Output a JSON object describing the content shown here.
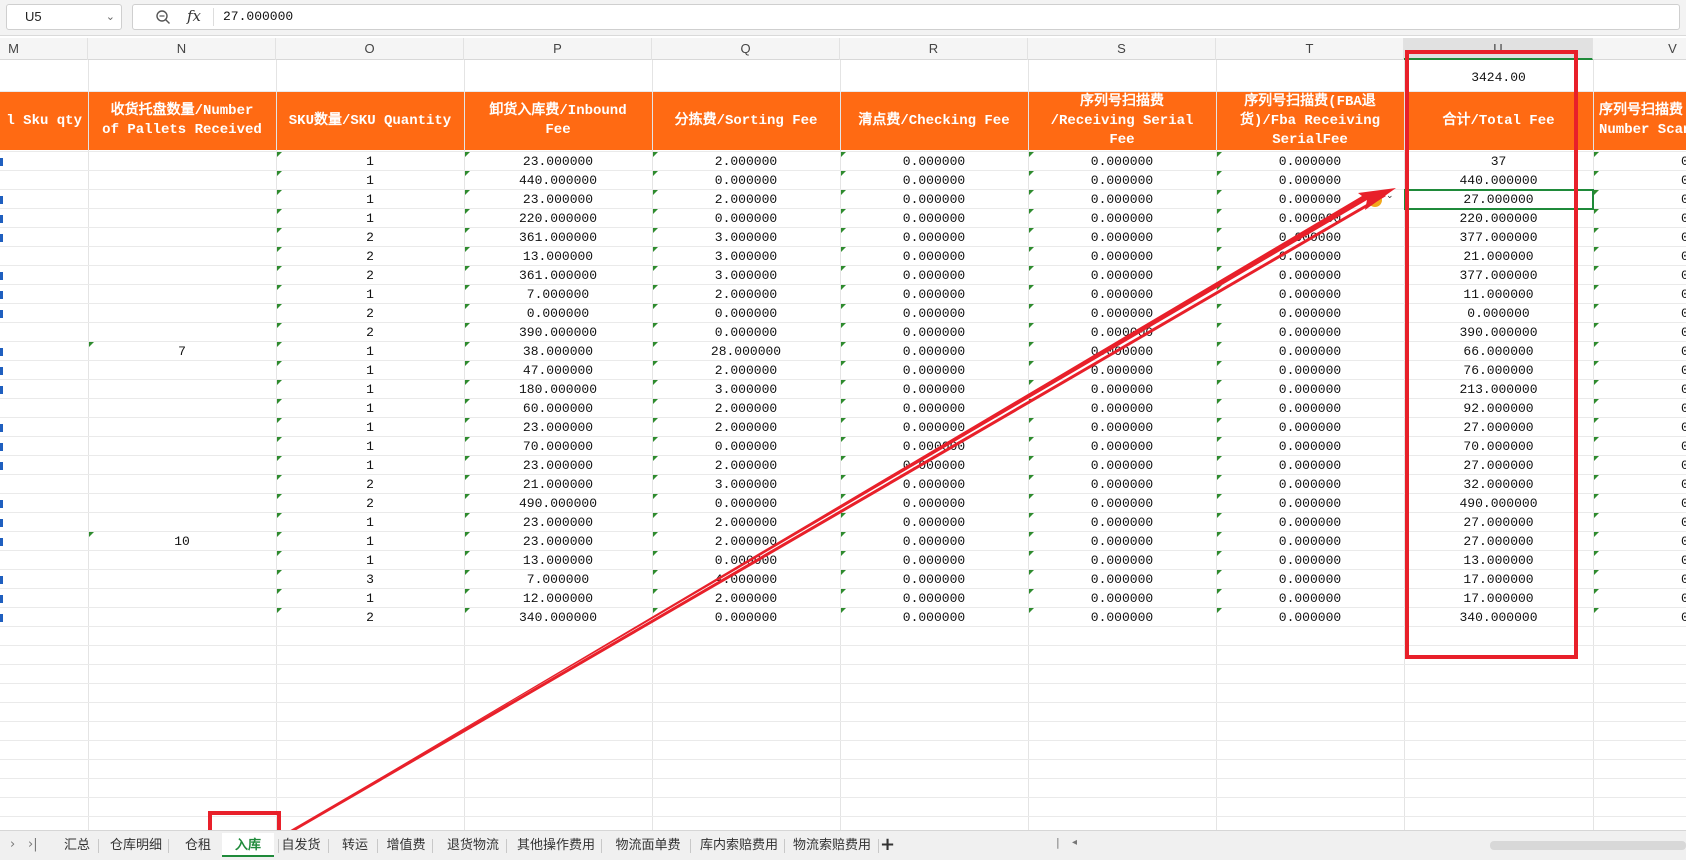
{
  "formula_bar": {
    "cell_ref": "U5",
    "formula": "27.000000",
    "fx_label": "fx"
  },
  "columns": [
    {
      "letter": "M"
    },
    {
      "letter": "N"
    },
    {
      "letter": "O"
    },
    {
      "letter": "P"
    },
    {
      "letter": "Q"
    },
    {
      "letter": "R"
    },
    {
      "letter": "S"
    },
    {
      "letter": "T"
    },
    {
      "letter": "U",
      "active": true
    },
    {
      "letter": "V"
    }
  ],
  "total_above": "3424.00",
  "headers": [
    "l Sku qty",
    "收货托盘数量/Number\nof Pallets Received",
    "SKU数量/SKU Quantity",
    "卸货入库费/Inbound\nFee",
    "分拣费/Sorting Fee",
    "清点费/Checking Fee",
    "序列号扫描费\n/Receiving Serial\nFee",
    "序列号扫描费(FBA退\n货)/Fba Receiving\nSerialFee",
    "合计/Total Fee",
    "序列号扫描费\nNumber Scan"
  ],
  "rows": [
    {
      "pallets": "",
      "qty": "1",
      "inbound": "23.000000",
      "sorting": "2.000000",
      "checking": "0.000000",
      "serial": "0.000000",
      "fba": "0.000000",
      "total": "37",
      "v": "0"
    },
    {
      "pallets": "",
      "qty": "1",
      "inbound": "440.000000",
      "sorting": "0.000000",
      "checking": "0.000000",
      "serial": "0.000000",
      "fba": "0.000000",
      "total": "440.000000",
      "v": "0"
    },
    {
      "pallets": "",
      "qty": "1",
      "inbound": "23.000000",
      "sorting": "2.000000",
      "checking": "0.000000",
      "serial": "0.000000",
      "fba": "0.000000",
      "total": "27.000000",
      "v": "0"
    },
    {
      "pallets": "",
      "qty": "1",
      "inbound": "220.000000",
      "sorting": "0.000000",
      "checking": "0.000000",
      "serial": "0.000000",
      "fba": "0.000000",
      "total": "220.000000",
      "v": "0"
    },
    {
      "pallets": "",
      "qty": "2",
      "inbound": "361.000000",
      "sorting": "3.000000",
      "checking": "0.000000",
      "serial": "0.000000",
      "fba": "0.000000",
      "total": "377.000000",
      "v": "0"
    },
    {
      "pallets": "",
      "qty": "2",
      "inbound": "13.000000",
      "sorting": "3.000000",
      "checking": "0.000000",
      "serial": "0.000000",
      "fba": "0.000000",
      "total": "21.000000",
      "v": "0"
    },
    {
      "pallets": "",
      "qty": "2",
      "inbound": "361.000000",
      "sorting": "3.000000",
      "checking": "0.000000",
      "serial": "0.000000",
      "fba": "0.000000",
      "total": "377.000000",
      "v": "0"
    },
    {
      "pallets": "",
      "qty": "1",
      "inbound": "7.000000",
      "sorting": "2.000000",
      "checking": "0.000000",
      "serial": "0.000000",
      "fba": "0.000000",
      "total": "11.000000",
      "v": "0"
    },
    {
      "pallets": "",
      "qty": "2",
      "inbound": "0.000000",
      "sorting": "0.000000",
      "checking": "0.000000",
      "serial": "0.000000",
      "fba": "0.000000",
      "total": "0.000000",
      "v": "0"
    },
    {
      "pallets": "",
      "qty": "2",
      "inbound": "390.000000",
      "sorting": "0.000000",
      "checking": "0.000000",
      "serial": "0.000000",
      "fba": "0.000000",
      "total": "390.000000",
      "v": "0"
    },
    {
      "pallets": "7",
      "qty": "1",
      "inbound": "38.000000",
      "sorting": "28.000000",
      "checking": "0.000000",
      "serial": "0.000000",
      "fba": "0.000000",
      "total": "66.000000",
      "v": "0"
    },
    {
      "pallets": "",
      "qty": "1",
      "inbound": "47.000000",
      "sorting": "2.000000",
      "checking": "0.000000",
      "serial": "0.000000",
      "fba": "0.000000",
      "total": "76.000000",
      "v": "0"
    },
    {
      "pallets": "",
      "qty": "1",
      "inbound": "180.000000",
      "sorting": "3.000000",
      "checking": "0.000000",
      "serial": "0.000000",
      "fba": "0.000000",
      "total": "213.000000",
      "v": "0"
    },
    {
      "pallets": "",
      "qty": "1",
      "inbound": "60.000000",
      "sorting": "2.000000",
      "checking": "0.000000",
      "serial": "0.000000",
      "fba": "0.000000",
      "total": "92.000000",
      "v": "0"
    },
    {
      "pallets": "",
      "qty": "1",
      "inbound": "23.000000",
      "sorting": "2.000000",
      "checking": "0.000000",
      "serial": "0.000000",
      "fba": "0.000000",
      "total": "27.000000",
      "v": "0"
    },
    {
      "pallets": "",
      "qty": "1",
      "inbound": "70.000000",
      "sorting": "0.000000",
      "checking": "0.000000",
      "serial": "0.000000",
      "fba": "0.000000",
      "total": "70.000000",
      "v": "0"
    },
    {
      "pallets": "",
      "qty": "1",
      "inbound": "23.000000",
      "sorting": "2.000000",
      "checking": "0.000000",
      "serial": "0.000000",
      "fba": "0.000000",
      "total": "27.000000",
      "v": "0"
    },
    {
      "pallets": "",
      "qty": "2",
      "inbound": "21.000000",
      "sorting": "3.000000",
      "checking": "0.000000",
      "serial": "0.000000",
      "fba": "0.000000",
      "total": "32.000000",
      "v": "0"
    },
    {
      "pallets": "",
      "qty": "2",
      "inbound": "490.000000",
      "sorting": "0.000000",
      "checking": "0.000000",
      "serial": "0.000000",
      "fba": "0.000000",
      "total": "490.000000",
      "v": "0"
    },
    {
      "pallets": "",
      "qty": "1",
      "inbound": "23.000000",
      "sorting": "2.000000",
      "checking": "0.000000",
      "serial": "0.000000",
      "fba": "0.000000",
      "total": "27.000000",
      "v": "0"
    },
    {
      "pallets": "10",
      "qty": "1",
      "inbound": "23.000000",
      "sorting": "2.000000",
      "checking": "0.000000",
      "serial": "0.000000",
      "fba": "0.000000",
      "total": "27.000000",
      "v": "0"
    },
    {
      "pallets": "",
      "qty": "1",
      "inbound": "13.000000",
      "sorting": "0.000000",
      "checking": "0.000000",
      "serial": "0.000000",
      "fba": "0.000000",
      "total": "13.000000",
      "v": "0"
    },
    {
      "pallets": "",
      "qty": "3",
      "inbound": "7.000000",
      "sorting": "4.000000",
      "checking": "0.000000",
      "serial": "0.000000",
      "fba": "0.000000",
      "total": "17.000000",
      "v": "0"
    },
    {
      "pallets": "",
      "qty": "1",
      "inbound": "12.000000",
      "sorting": "2.000000",
      "checking": "0.000000",
      "serial": "0.000000",
      "fba": "0.000000",
      "total": "17.000000",
      "v": "0"
    },
    {
      "pallets": "",
      "qty": "2",
      "inbound": "340.000000",
      "sorting": "0.000000",
      "checking": "0.000000",
      "serial": "0.000000",
      "fba": "0.000000",
      "total": "340.000000",
      "v": "0"
    }
  ],
  "sheet_tabs": [
    "汇总",
    "仓库明细",
    "仓租",
    "入库",
    "自发货",
    "转运",
    "增值费",
    "退货物流",
    "其他操作费用",
    "物流面单费",
    "库内索赔费用",
    "物流索赔费用"
  ],
  "active_tab": "入库",
  "colors": {
    "header_orange": "#ff6a13",
    "annotation_red": "#e8202a",
    "selection_green": "#1f8a3a"
  },
  "icons": {
    "zoom": "zoom-icon",
    "fx": "fx-icon",
    "warning": "warning-icon",
    "add_sheet": "plus-icon"
  }
}
